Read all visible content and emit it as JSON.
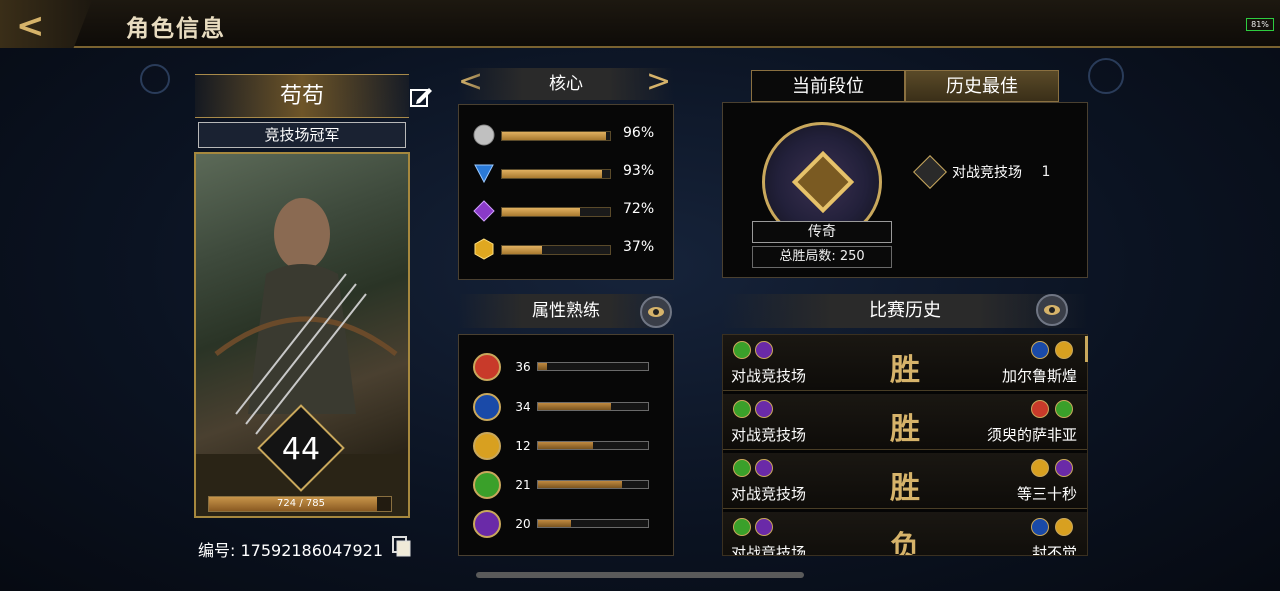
{
  "header": {
    "title": "角色信息",
    "back_icon": "back-arrow-icon",
    "battery": "81%"
  },
  "profile": {
    "name": "苟苟",
    "title": "竞技场冠军",
    "level": "44",
    "xp_text": "724 / 785",
    "xp_progress": 0.922,
    "id_label": "编号: 17592186047921"
  },
  "core": {
    "label": "核心",
    "items": [
      {
        "icon": "silver-orb-icon",
        "color": "#c0c0c0",
        "pct": "96%",
        "value": 96
      },
      {
        "icon": "blue-triangle-icon",
        "color": "#2a7ad8",
        "pct": "93%",
        "value": 93
      },
      {
        "icon": "purple-gem-icon",
        "color": "#8a3ac8",
        "pct": "72%",
        "value": 72
      },
      {
        "icon": "gold-hexagon-icon",
        "color": "#e0a820",
        "pct": "37%",
        "value": 37
      }
    ]
  },
  "attributes": {
    "label": "属性熟练",
    "items": [
      {
        "icon": "strength-icon",
        "color": "#c83a2a",
        "value": "36",
        "fill": 0.08
      },
      {
        "icon": "book-icon",
        "color": "#1a4aa8",
        "value": "34",
        "fill": 0.66
      },
      {
        "icon": "agility-icon",
        "color": "#d8a020",
        "value": "12",
        "fill": 0.5
      },
      {
        "icon": "nature-icon",
        "color": "#3aa02a",
        "value": "21",
        "fill": 0.76
      },
      {
        "icon": "anvil-icon",
        "color": "#6a2aa8",
        "value": "20",
        "fill": 0.3
      }
    ]
  },
  "rank": {
    "tab_current": "当前段位",
    "tab_best": "历史最佳",
    "tier": "传奇",
    "total_wins": "总胜局数: 250",
    "mode": "对战竞技场",
    "mode_count": "1"
  },
  "history": {
    "label": "比赛历史",
    "matches": [
      {
        "mode": "对战竞技场",
        "result": "胜",
        "opponent": "加尔鲁斯煌",
        "mine": [
          "#3aa02a",
          "#6a2aa8"
        ],
        "theirs": [
          "#1a4aa8",
          "#d8a020"
        ]
      },
      {
        "mode": "对战竞技场",
        "result": "胜",
        "opponent": "须臾的萨非亚",
        "mine": [
          "#3aa02a",
          "#6a2aa8"
        ],
        "theirs": [
          "#c83a2a",
          "#3aa02a"
        ]
      },
      {
        "mode": "对战竞技场",
        "result": "胜",
        "opponent": "等三十秒",
        "mine": [
          "#3aa02a",
          "#6a2aa8"
        ],
        "theirs": [
          "#d8a020",
          "#6a2aa8"
        ]
      },
      {
        "mode": "对战竞技场",
        "result": "负",
        "opponent": "封不觉",
        "mine": [
          "#3aa02a",
          "#6a2aa8"
        ],
        "theirs": [
          "#1a4aa8",
          "#d8a020"
        ]
      }
    ]
  }
}
